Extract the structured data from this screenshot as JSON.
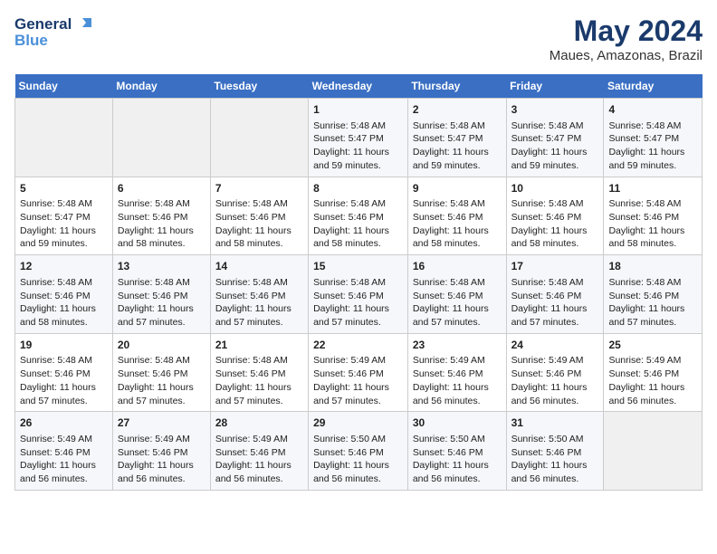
{
  "header": {
    "logo_line1": "General",
    "logo_line2": "Blue",
    "main_title": "May 2024",
    "subtitle": "Maues, Amazonas, Brazil"
  },
  "calendar": {
    "days_of_week": [
      "Sunday",
      "Monday",
      "Tuesday",
      "Wednesday",
      "Thursday",
      "Friday",
      "Saturday"
    ],
    "weeks": [
      [
        {
          "day": "",
          "sunrise": "",
          "sunset": "",
          "daylight": "",
          "empty": true
        },
        {
          "day": "",
          "sunrise": "",
          "sunset": "",
          "daylight": "",
          "empty": true
        },
        {
          "day": "",
          "sunrise": "",
          "sunset": "",
          "daylight": "",
          "empty": true
        },
        {
          "day": "1",
          "sunrise": "Sunrise: 5:48 AM",
          "sunset": "Sunset: 5:47 PM",
          "daylight": "Daylight: 11 hours and 59 minutes.",
          "empty": false
        },
        {
          "day": "2",
          "sunrise": "Sunrise: 5:48 AM",
          "sunset": "Sunset: 5:47 PM",
          "daylight": "Daylight: 11 hours and 59 minutes.",
          "empty": false
        },
        {
          "day": "3",
          "sunrise": "Sunrise: 5:48 AM",
          "sunset": "Sunset: 5:47 PM",
          "daylight": "Daylight: 11 hours and 59 minutes.",
          "empty": false
        },
        {
          "day": "4",
          "sunrise": "Sunrise: 5:48 AM",
          "sunset": "Sunset: 5:47 PM",
          "daylight": "Daylight: 11 hours and 59 minutes.",
          "empty": false
        }
      ],
      [
        {
          "day": "5",
          "sunrise": "Sunrise: 5:48 AM",
          "sunset": "Sunset: 5:47 PM",
          "daylight": "Daylight: 11 hours and 59 minutes.",
          "empty": false
        },
        {
          "day": "6",
          "sunrise": "Sunrise: 5:48 AM",
          "sunset": "Sunset: 5:46 PM",
          "daylight": "Daylight: 11 hours and 58 minutes.",
          "empty": false
        },
        {
          "day": "7",
          "sunrise": "Sunrise: 5:48 AM",
          "sunset": "Sunset: 5:46 PM",
          "daylight": "Daylight: 11 hours and 58 minutes.",
          "empty": false
        },
        {
          "day": "8",
          "sunrise": "Sunrise: 5:48 AM",
          "sunset": "Sunset: 5:46 PM",
          "daylight": "Daylight: 11 hours and 58 minutes.",
          "empty": false
        },
        {
          "day": "9",
          "sunrise": "Sunrise: 5:48 AM",
          "sunset": "Sunset: 5:46 PM",
          "daylight": "Daylight: 11 hours and 58 minutes.",
          "empty": false
        },
        {
          "day": "10",
          "sunrise": "Sunrise: 5:48 AM",
          "sunset": "Sunset: 5:46 PM",
          "daylight": "Daylight: 11 hours and 58 minutes.",
          "empty": false
        },
        {
          "day": "11",
          "sunrise": "Sunrise: 5:48 AM",
          "sunset": "Sunset: 5:46 PM",
          "daylight": "Daylight: 11 hours and 58 minutes.",
          "empty": false
        }
      ],
      [
        {
          "day": "12",
          "sunrise": "Sunrise: 5:48 AM",
          "sunset": "Sunset: 5:46 PM",
          "daylight": "Daylight: 11 hours and 58 minutes.",
          "empty": false
        },
        {
          "day": "13",
          "sunrise": "Sunrise: 5:48 AM",
          "sunset": "Sunset: 5:46 PM",
          "daylight": "Daylight: 11 hours and 57 minutes.",
          "empty": false
        },
        {
          "day": "14",
          "sunrise": "Sunrise: 5:48 AM",
          "sunset": "Sunset: 5:46 PM",
          "daylight": "Daylight: 11 hours and 57 minutes.",
          "empty": false
        },
        {
          "day": "15",
          "sunrise": "Sunrise: 5:48 AM",
          "sunset": "Sunset: 5:46 PM",
          "daylight": "Daylight: 11 hours and 57 minutes.",
          "empty": false
        },
        {
          "day": "16",
          "sunrise": "Sunrise: 5:48 AM",
          "sunset": "Sunset: 5:46 PM",
          "daylight": "Daylight: 11 hours and 57 minutes.",
          "empty": false
        },
        {
          "day": "17",
          "sunrise": "Sunrise: 5:48 AM",
          "sunset": "Sunset: 5:46 PM",
          "daylight": "Daylight: 11 hours and 57 minutes.",
          "empty": false
        },
        {
          "day": "18",
          "sunrise": "Sunrise: 5:48 AM",
          "sunset": "Sunset: 5:46 PM",
          "daylight": "Daylight: 11 hours and 57 minutes.",
          "empty": false
        }
      ],
      [
        {
          "day": "19",
          "sunrise": "Sunrise: 5:48 AM",
          "sunset": "Sunset: 5:46 PM",
          "daylight": "Daylight: 11 hours and 57 minutes.",
          "empty": false
        },
        {
          "day": "20",
          "sunrise": "Sunrise: 5:48 AM",
          "sunset": "Sunset: 5:46 PM",
          "daylight": "Daylight: 11 hours and 57 minutes.",
          "empty": false
        },
        {
          "day": "21",
          "sunrise": "Sunrise: 5:48 AM",
          "sunset": "Sunset: 5:46 PM",
          "daylight": "Daylight: 11 hours and 57 minutes.",
          "empty": false
        },
        {
          "day": "22",
          "sunrise": "Sunrise: 5:49 AM",
          "sunset": "Sunset: 5:46 PM",
          "daylight": "Daylight: 11 hours and 57 minutes.",
          "empty": false
        },
        {
          "day": "23",
          "sunrise": "Sunrise: 5:49 AM",
          "sunset": "Sunset: 5:46 PM",
          "daylight": "Daylight: 11 hours and 56 minutes.",
          "empty": false
        },
        {
          "day": "24",
          "sunrise": "Sunrise: 5:49 AM",
          "sunset": "Sunset: 5:46 PM",
          "daylight": "Daylight: 11 hours and 56 minutes.",
          "empty": false
        },
        {
          "day": "25",
          "sunrise": "Sunrise: 5:49 AM",
          "sunset": "Sunset: 5:46 PM",
          "daylight": "Daylight: 11 hours and 56 minutes.",
          "empty": false
        }
      ],
      [
        {
          "day": "26",
          "sunrise": "Sunrise: 5:49 AM",
          "sunset": "Sunset: 5:46 PM",
          "daylight": "Daylight: 11 hours and 56 minutes.",
          "empty": false
        },
        {
          "day": "27",
          "sunrise": "Sunrise: 5:49 AM",
          "sunset": "Sunset: 5:46 PM",
          "daylight": "Daylight: 11 hours and 56 minutes.",
          "empty": false
        },
        {
          "day": "28",
          "sunrise": "Sunrise: 5:49 AM",
          "sunset": "Sunset: 5:46 PM",
          "daylight": "Daylight: 11 hours and 56 minutes.",
          "empty": false
        },
        {
          "day": "29",
          "sunrise": "Sunrise: 5:50 AM",
          "sunset": "Sunset: 5:46 PM",
          "daylight": "Daylight: 11 hours and 56 minutes.",
          "empty": false
        },
        {
          "day": "30",
          "sunrise": "Sunrise: 5:50 AM",
          "sunset": "Sunset: 5:46 PM",
          "daylight": "Daylight: 11 hours and 56 minutes.",
          "empty": false
        },
        {
          "day": "31",
          "sunrise": "Sunrise: 5:50 AM",
          "sunset": "Sunset: 5:46 PM",
          "daylight": "Daylight: 11 hours and 56 minutes.",
          "empty": false
        },
        {
          "day": "",
          "sunrise": "",
          "sunset": "",
          "daylight": "",
          "empty": true
        }
      ]
    ]
  }
}
